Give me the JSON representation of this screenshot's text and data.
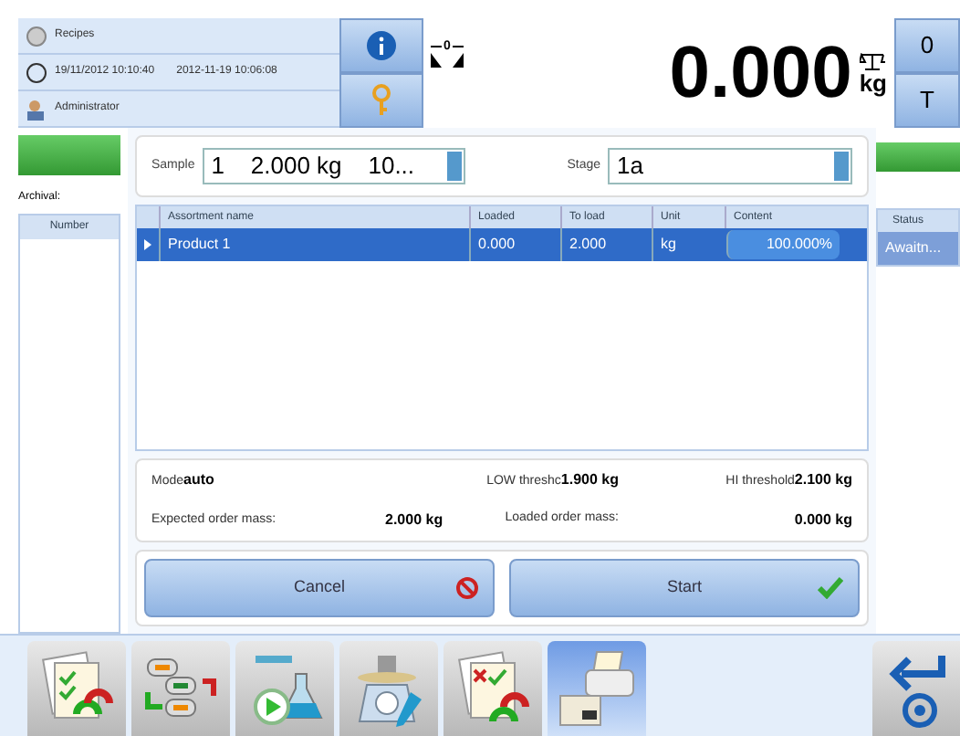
{
  "header": {
    "recipes": "Recipes",
    "date_local": "19/11/2012 10:10:40",
    "date_iso": "2012-11-19 10:06:08",
    "user": "Administrator"
  },
  "display": {
    "zero_mark": "0",
    "weight": "0.000",
    "unit": "kg",
    "zero_button": "0",
    "tare_button": "T"
  },
  "archival": {
    "label": "Archival:",
    "column": "Number"
  },
  "sample": {
    "label": "Sample",
    "value": "1    2.000 kg    10..."
  },
  "stage": {
    "label": "Stage",
    "value": "1a"
  },
  "table": {
    "columns": [
      "Assortment name",
      "Loaded",
      "To load",
      "Unit",
      "Content"
    ],
    "rows": [
      {
        "cells": [
          "Product 1",
          "0.000",
          "2.000",
          "kg",
          "100.000%"
        ],
        "selected": true
      }
    ]
  },
  "status": {
    "column": "Status",
    "value": "Awaitn..."
  },
  "info": {
    "mode_label": "Mode",
    "mode_value": "auto",
    "low_label": "LOW threshc",
    "low_value": "1.900 kg",
    "hi_label": "HI threshold",
    "hi_value": "2.100 kg",
    "expected_label": "Expected order mass:",
    "expected_value": "2.000 kg",
    "loaded_label": "Loaded order mass:",
    "loaded_value": "0.000 kg"
  },
  "buttons": {
    "cancel": "Cancel",
    "start": "Start"
  },
  "toolbar": [
    {
      "kind": "checklist",
      "selected": false
    },
    {
      "kind": "exchange",
      "selected": false
    },
    {
      "kind": "flask",
      "selected": false
    },
    {
      "kind": "scale",
      "selected": false
    },
    {
      "kind": "report",
      "selected": false
    },
    {
      "kind": "printer",
      "selected": true
    }
  ]
}
